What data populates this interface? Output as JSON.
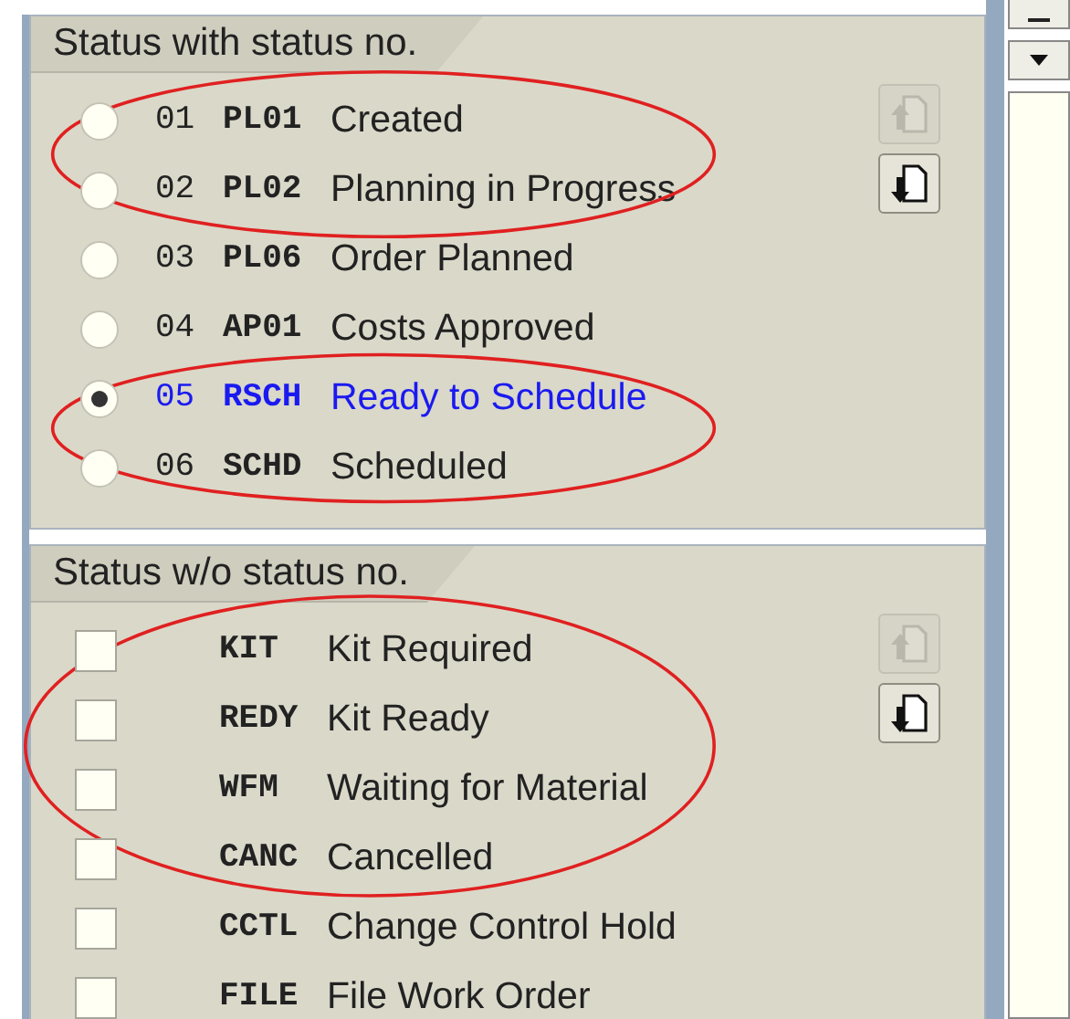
{
  "sections": [
    {
      "title": "Status with status no.",
      "kind": "radio",
      "buttons": [
        {
          "kind": "up",
          "disabled": true
        },
        {
          "kind": "down",
          "disabled": false
        }
      ],
      "rows": [
        {
          "number": "01",
          "code": "PL01",
          "text": "Created",
          "selected": false
        },
        {
          "number": "02",
          "code": "PL02",
          "text": "Planning in Progress",
          "selected": false
        },
        {
          "number": "03",
          "code": "PL06",
          "text": "Order Planned",
          "selected": false
        },
        {
          "number": "04",
          "code": "AP01",
          "text": "Costs Approved",
          "selected": false
        },
        {
          "number": "05",
          "code": "RSCH",
          "text": "Ready to Schedule",
          "selected": true
        },
        {
          "number": "06",
          "code": "SCHD",
          "text": "Scheduled",
          "selected": false
        }
      ]
    },
    {
      "title": "Status w/o status no.",
      "kind": "checkbox",
      "buttons": [
        {
          "kind": "up",
          "disabled": true
        },
        {
          "kind": "down",
          "disabled": false
        }
      ],
      "rows": [
        {
          "code": "KIT",
          "text": "Kit Required",
          "checked": false
        },
        {
          "code": "REDY",
          "text": "Kit Ready",
          "checked": false
        },
        {
          "code": "WFM",
          "text": "Waiting for Material",
          "checked": false
        },
        {
          "code": "CANC",
          "text": "Cancelled",
          "checked": false
        },
        {
          "code": "CCTL",
          "text": "Change Control Hold",
          "checked": false
        },
        {
          "code": "FILE",
          "text": "File Work Order",
          "checked": false
        }
      ]
    }
  ]
}
